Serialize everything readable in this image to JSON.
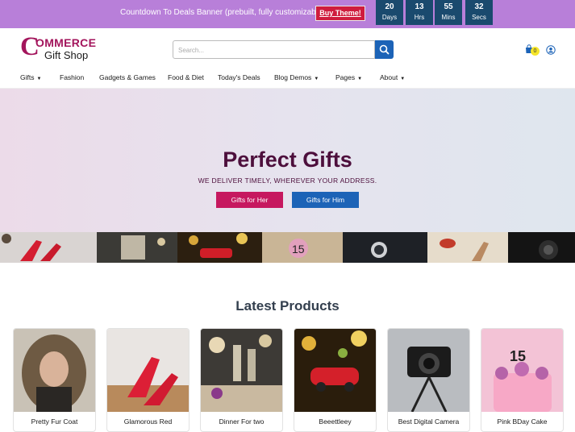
{
  "topbar": {
    "message": "Countdown To Deals Banner (prebuilt, fully customizable)",
    "buy_label": "Buy Theme!",
    "countdown": [
      {
        "value": "20",
        "unit": "Days"
      },
      {
        "value": "13",
        "unit": "Hrs"
      },
      {
        "value": "55",
        "unit": "Mins"
      },
      {
        "value": "32",
        "unit": "Secs"
      }
    ]
  },
  "header": {
    "logo_c": "C",
    "logo_commerce": "OMMERCE",
    "logo_gift": "Gift Shop",
    "search_placeholder": "Search...",
    "search_icon": "search-icon",
    "cart_icon": "shopping-bag-icon",
    "cart_count": "0",
    "user_icon": "user-icon"
  },
  "nav": {
    "items": [
      {
        "label": "Gifts",
        "dropdown": true
      },
      {
        "label": "Fashion",
        "dropdown": false
      },
      {
        "label": "Gadgets & Games",
        "dropdown": false
      },
      {
        "label": "Food & Diet",
        "dropdown": false
      },
      {
        "label": "Today's Deals",
        "dropdown": false
      },
      {
        "label": "Blog Demos",
        "dropdown": true
      },
      {
        "label": "Pages",
        "dropdown": true
      },
      {
        "label": "About",
        "dropdown": true
      }
    ]
  },
  "hero": {
    "title": "Perfect Gifts",
    "subtitle": "WE DELIVER TIMELY, WHEREVER YOUR ADDRESS.",
    "btn_her": "Gifts for Her",
    "btn_him": "Gifts for Him"
  },
  "products": {
    "title": "Latest Products",
    "items": [
      {
        "name": "Pretty Fur Coat"
      },
      {
        "name": "Glamorous Red"
      },
      {
        "name": "Dinner For two"
      },
      {
        "name": "Beeettleey"
      },
      {
        "name": "Best Digital Camera"
      },
      {
        "name": "Pink BDay Cake"
      }
    ]
  },
  "colors": {
    "topbar": "#b87fd9",
    "brand": "#a3155c",
    "accent_blue": "#1c63b7",
    "accent_pink": "#c6185f",
    "hero_text": "#4d0f3c"
  }
}
